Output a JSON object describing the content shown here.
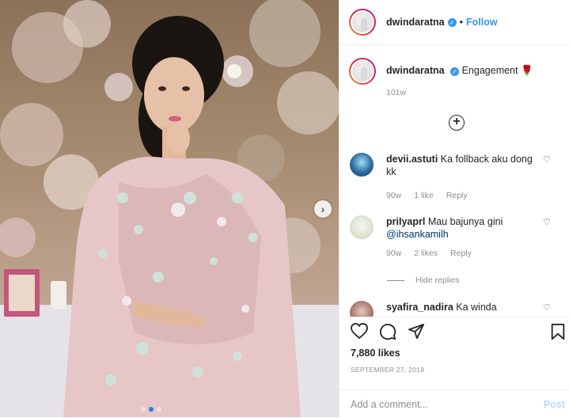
{
  "header": {
    "username": "dwindaratna",
    "separator": "•",
    "follow_label": "Follow"
  },
  "caption": {
    "username": "dwindaratna",
    "text": "Engagement 🌹",
    "time": "101w"
  },
  "comments": [
    {
      "username": "devii.astuti",
      "text": "Ka follback aku dong kk",
      "time": "90w",
      "likes": "1 like",
      "reply_label": "Reply"
    },
    {
      "username": "priIyaprl",
      "text": "Mau bajunya gini",
      "mention": "@ihsankamilh",
      "time": "90w",
      "likes": "2 likes",
      "reply_label": "Reply"
    },
    {
      "username": "syafira_nadira",
      "text": "Ka winda"
    }
  ],
  "hide_replies_label": "Hide replies",
  "likes_count": "7,880 likes",
  "date": "SEPTEMBER 27, 2018",
  "add_comment": {
    "placeholder": "Add a comment...",
    "post_label": "Post"
  },
  "carousel": {
    "next_icon": "chevron-right-icon",
    "current_index": 1,
    "total": 3
  },
  "colors": {
    "link_blue": "#3897f0",
    "post_disabled": "#b3dbff",
    "muted_text": "#8e8e8e"
  }
}
